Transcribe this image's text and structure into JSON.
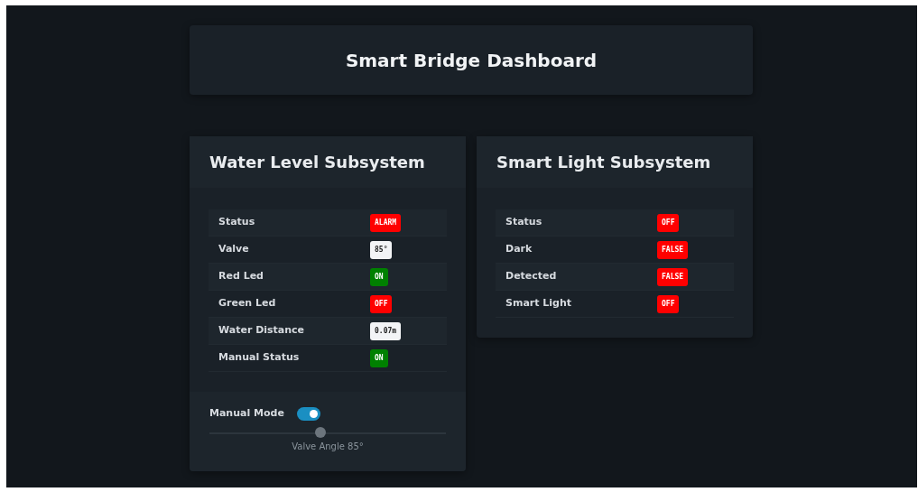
{
  "header": {
    "title": "Smart Bridge Dashboard"
  },
  "panels": [
    {
      "title": "Water Level Subsystem",
      "rows": [
        {
          "label": "Status",
          "value": "ALARM",
          "kind": "danger"
        },
        {
          "label": "Valve",
          "value": "85°",
          "kind": "value"
        },
        {
          "label": "Red Led",
          "value": "ON",
          "kind": "success"
        },
        {
          "label": "Green Led",
          "value": "OFF",
          "kind": "danger"
        },
        {
          "label": "Water Distance",
          "value": "0.07m",
          "kind": "value"
        },
        {
          "label": "Manual Status",
          "value": "ON",
          "kind": "success"
        }
      ],
      "controls": {
        "toggle_label": "Manual Mode",
        "on": true,
        "slider": {
          "level": 0.47,
          "caption": "Valve Angle 85°"
        }
      }
    },
    {
      "title": "Smart Light Subsystem",
      "rows": [
        {
          "label": "Status",
          "value": "OFF",
          "kind": "danger"
        },
        {
          "label": "Dark",
          "value": "FALSE",
          "kind": "danger"
        },
        {
          "label": "Detected",
          "value": "FALSE",
          "kind": "danger"
        },
        {
          "label": "Smart Light",
          "value": "OFF",
          "kind": "danger"
        }
      ]
    }
  ]
}
